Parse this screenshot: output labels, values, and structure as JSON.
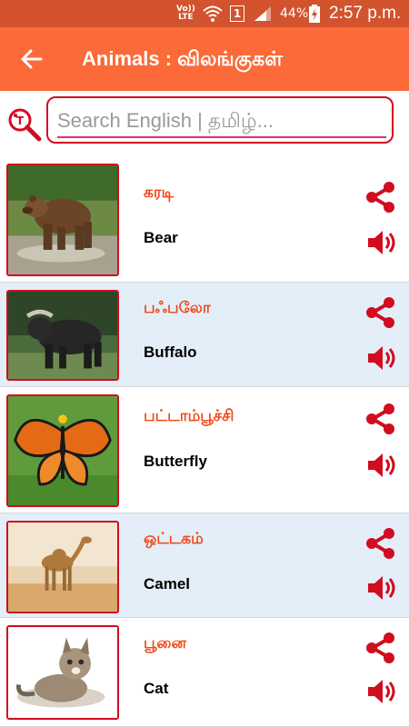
{
  "status_bar": {
    "volte_top": "Vo))",
    "volte_bottom": "LTE",
    "sim_slot": "1",
    "battery_percent": "44%",
    "time": "2:57 p.m.",
    "icons": [
      "wifi-icon",
      "signal-icon",
      "battery-charging-icon"
    ]
  },
  "app_bar": {
    "title": "Animals : விலங்குகள்",
    "back_icon": "arrow-left-icon"
  },
  "search": {
    "placeholder": "Search English | தமிழ்...",
    "value": "",
    "icon": "translate-search-icon"
  },
  "colors": {
    "status_bar": "#d2532e",
    "app_bar": "#fb6a38",
    "accent_red": "#d10d1f",
    "tamil_text": "#f0491a",
    "alt_row": "#e3eef8"
  },
  "animals": [
    {
      "tamil": "கரடி",
      "english": "Bear",
      "image": "bear-photo"
    },
    {
      "tamil": "பஃபலோ",
      "english": "Buffalo",
      "image": "buffalo-photo"
    },
    {
      "tamil": "பட்டாம்பூச்சி",
      "english": "Butterfly",
      "image": "butterfly-photo"
    },
    {
      "tamil": "ஒட்டகம்",
      "english": "Camel",
      "image": "camel-photo"
    },
    {
      "tamil": "பூனை",
      "english": "Cat",
      "image": "cat-photo"
    }
  ]
}
